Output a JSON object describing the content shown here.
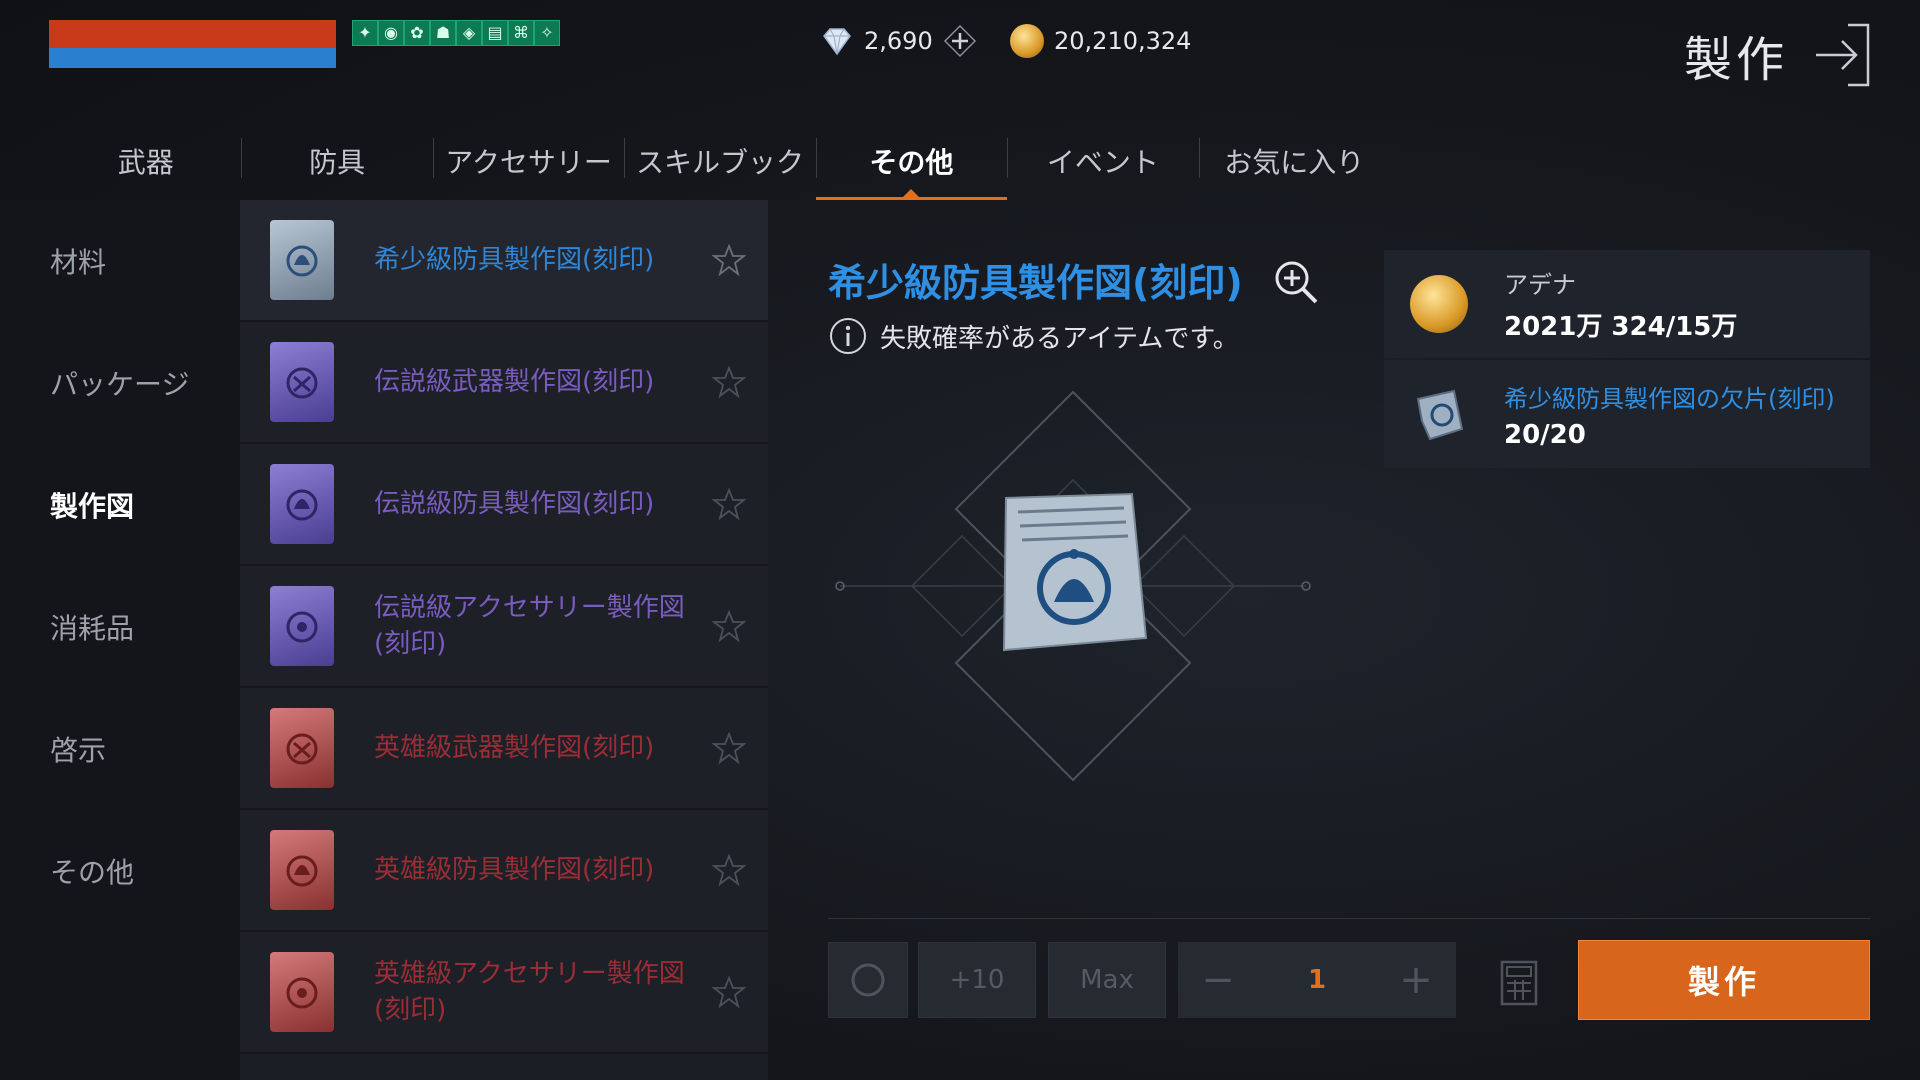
{
  "status": {
    "hp_color": "#c83a1a",
    "mp_color": "#2a7fcf",
    "buff_icons": [
      "buff-1-icon",
      "buff-2-icon",
      "buff-3-icon",
      "buff-4-icon",
      "buff-5-icon",
      "buff-6-icon",
      "buff-7-icon",
      "buff-8-icon"
    ]
  },
  "currency": {
    "diamonds": "2,690",
    "gold": "20,210,324"
  },
  "header": {
    "title": "製作"
  },
  "tabs": [
    {
      "label": "武器"
    },
    {
      "label": "防具"
    },
    {
      "label": "アクセサリー"
    },
    {
      "label": "スキルブック"
    },
    {
      "label": "その他",
      "active": true
    },
    {
      "label": "イベント"
    },
    {
      "label": "お気に入り"
    }
  ],
  "categories": [
    {
      "label": "材料"
    },
    {
      "label": "パッケージ"
    },
    {
      "label": "製作図",
      "active": true
    },
    {
      "label": "消耗品"
    },
    {
      "label": "啓示"
    },
    {
      "label": "その他"
    }
  ],
  "items": [
    {
      "name": "希少級防具製作図(刻印)",
      "grade": "rare"
    },
    {
      "name": "伝説級武器製作図(刻印)",
      "grade": "legend"
    },
    {
      "name": "伝説級防具製作図(刻印)",
      "grade": "legend"
    },
    {
      "name": "伝説級アクセサリー製作図(刻印)",
      "grade": "legend"
    },
    {
      "name": "英雄級武器製作図(刻印)",
      "grade": "hero"
    },
    {
      "name": "英雄級防具製作図(刻印)",
      "grade": "hero"
    },
    {
      "name": "英雄級アクセサリー製作図(刻印)",
      "grade": "hero"
    }
  ],
  "detail": {
    "title": "希少級防具製作図(刻印)",
    "warning": "失敗確率があるアイテムです。"
  },
  "materials": [
    {
      "name": "アデナ",
      "qty": "2021万 324/15万"
    },
    {
      "name": "希少級防具製作図の欠片(刻印)",
      "qty": "20/20"
    }
  ],
  "controls": {
    "plus10": "+10",
    "max": "Max",
    "minus": "−",
    "plus": "+",
    "quantity": "1",
    "craft_label": "製作"
  },
  "colors": {
    "accent": "#e0701d",
    "rare": "#2f86d6",
    "legend": "#7a5bbf",
    "hero": "#9a2d35"
  }
}
